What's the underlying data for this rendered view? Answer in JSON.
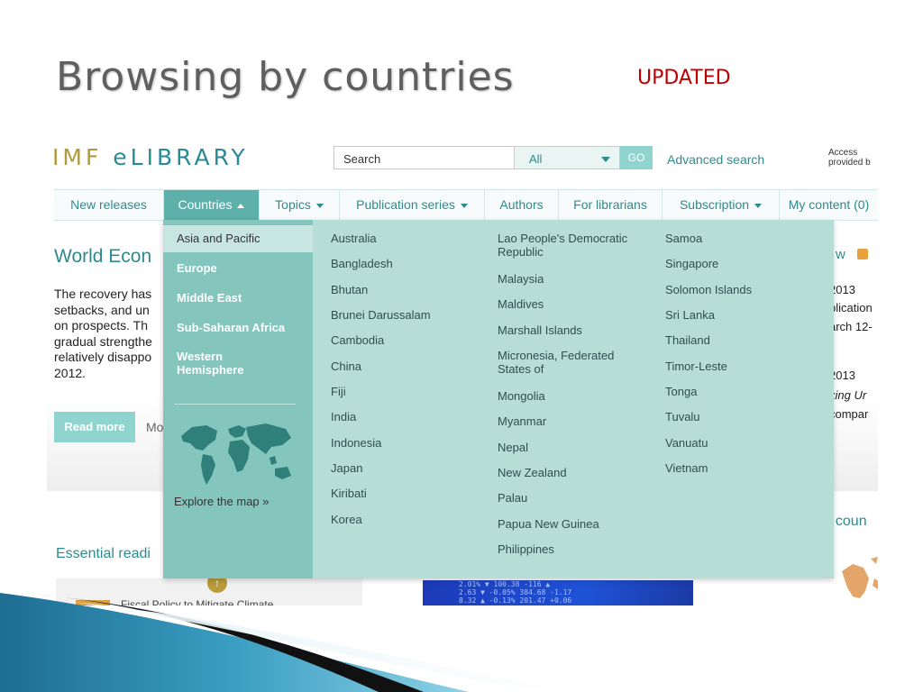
{
  "slide": {
    "title": "Browsing by countries",
    "badge": "UPDATED"
  },
  "header": {
    "logo_imf": "IMF",
    "logo_elibrary": "eLIBRARY",
    "search_placeholder": "Search",
    "scope_value": "All",
    "go_label": "GO",
    "advanced_search": "Advanced search",
    "access_line1": "Access",
    "access_line2": "provided b"
  },
  "nav": [
    "New releases",
    "Countries",
    "Topics",
    "Publication series",
    "Authors",
    "For librarians",
    "Subscription",
    "My content (0)"
  ],
  "page": {
    "article_title": "World Econ",
    "article_lines": [
      "The recovery has",
      "setbacks, and un",
      "on prospects. Th",
      "gradual strengthe",
      "relatively disappo",
      "2012."
    ],
    "read_more": "Read more",
    "more_link": "Mo",
    "essential_reading": "Essential readi",
    "bottom_text": "Fiscal Policy to Mitigate Climate",
    "stock_ticker": [
      "2.01% ▼ 100.38  -116  ▲",
      "2.63 ▼  -0.05%  384.68 -1.17",
      "8.32 ▲ -0.13%  201.47 +0.06"
    ],
    "right_w": "w",
    "right_fragments": [
      "2013",
      "plication",
      "arch 12-",
      "2013",
      "king Ur",
      "compar"
    ],
    "by_country": "/ coun"
  },
  "dropdown": {
    "regions": [
      "Asia and Pacific",
      "Europe",
      "Middle East",
      "Sub-Saharan Africa",
      "Western",
      "Hemisphere"
    ],
    "explore_map": "Explore the map »",
    "col1": [
      "Australia",
      "Bangladesh",
      "Bhutan",
      "Brunei Darussalam",
      "Cambodia",
      "China",
      "Fiji",
      "India",
      "Indonesia",
      "Japan",
      "Kiribati",
      "Korea"
    ],
    "col2": [
      "Lao People's Democratic",
      "Republic",
      "Malaysia",
      "Maldives",
      "Marshall Islands",
      "Micronesia, Federated",
      "States of",
      "Mongolia",
      "Myanmar",
      "Nepal",
      "New Zealand",
      "Palau",
      "Papua New Guinea",
      "Philippines"
    ],
    "col3": [
      "Samoa",
      "Singapore",
      "Solomon Islands",
      "Sri Lanka",
      "Thailand",
      "Timor-Leste",
      "Tonga",
      "Tuvalu",
      "Vanuatu",
      "Vietnam"
    ]
  },
  "colors": {
    "brand_teal": "#2f8a8e",
    "logo_gold": "#b39a3c",
    "menu_active": "#5eb0aa",
    "dropdown_bg": "#b7ddd7",
    "dropdown_left": "#84c6bd",
    "title_red": "#c00000"
  },
  "icons": [
    "chevron-down-icon",
    "chevron-up-icon",
    "rss-icon",
    "world-map-icon",
    "scroll-up-icon"
  ]
}
